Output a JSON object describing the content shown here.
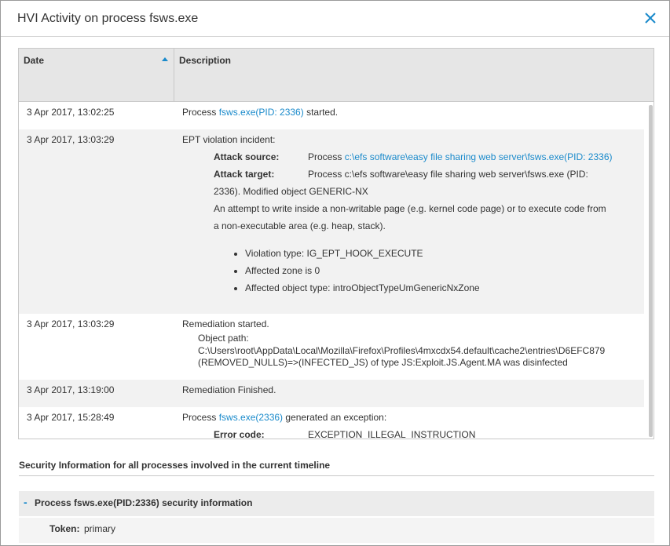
{
  "dialog": {
    "title": "HVI Activity on process fsws.exe",
    "close_icon": "close-icon",
    "accent_color": "#1a8acb"
  },
  "grid": {
    "columns": {
      "date": "Date",
      "description": "Description"
    },
    "sort_icon": "sort-ascending-icon",
    "rows": [
      {
        "date": "3 Apr 2017, 13:02:25",
        "desc": {
          "prefix": "Process ",
          "link": "fsws.exe(PID: 2336)",
          "suffix": " started."
        }
      },
      {
        "date": "3 Apr 2017, 13:03:29",
        "desc": {
          "title": "EPT violation incident:",
          "attack_source_label": "Attack source:",
          "attack_source_prefix": "Process ",
          "attack_source_link": "c:\\efs software\\easy file sharing web server\\fsws.exe(PID: 2336)",
          "attack_target_label": "Attack target:",
          "attack_target_line1": "Process c:\\efs software\\easy file sharing web server\\fsws.exe (PID:",
          "attack_target_line2": "2336). Modified object GENERIC-NX",
          "message_line1": "An attempt to write inside a non-writable page (e.g. kernel code page) or to execute code from",
          "message_line2": "a non-executable area (e.g. heap, stack).",
          "bullets": [
            "Violation type: IG_EPT_HOOK_EXECUTE",
            "Affected zone is 0",
            "Affected object type: introObjectTypeUmGenericNxZone"
          ]
        }
      },
      {
        "date": "3 Apr 2017, 13:03:29",
        "desc": {
          "title": "Remediation started.",
          "path_label": "Object path:",
          "path_line1": "C:\\Users\\root\\AppData\\Local\\Mozilla\\Firefox\\Profiles\\4mxcdx54.default\\cache2\\entries\\D6EFC879",
          "path_line2": "(REMOVED_NULLS)=>(INFECTED_JS) of type JS:Exploit.JS.Agent.MA was disinfected"
        }
      },
      {
        "date": "3 Apr 2017, 13:19:00",
        "desc": {
          "text": "Remediation Finished."
        }
      },
      {
        "date": "3 Apr 2017, 15:28:49",
        "desc": {
          "prefix": "Process ",
          "link": "fsws.exe(2336)",
          "suffix": " generated an exception:",
          "error_label": "Error code:",
          "error_value": "EXCEPTION_ILLEGAL_INSTRUCTION"
        }
      }
    ]
  },
  "security": {
    "title": "Security Information for all processes involved in the current timeline",
    "process": {
      "toggle": "-",
      "title": "Process fsws.exe(PID:2336) security information",
      "token_label": "Token:",
      "token_value": "primary"
    }
  }
}
